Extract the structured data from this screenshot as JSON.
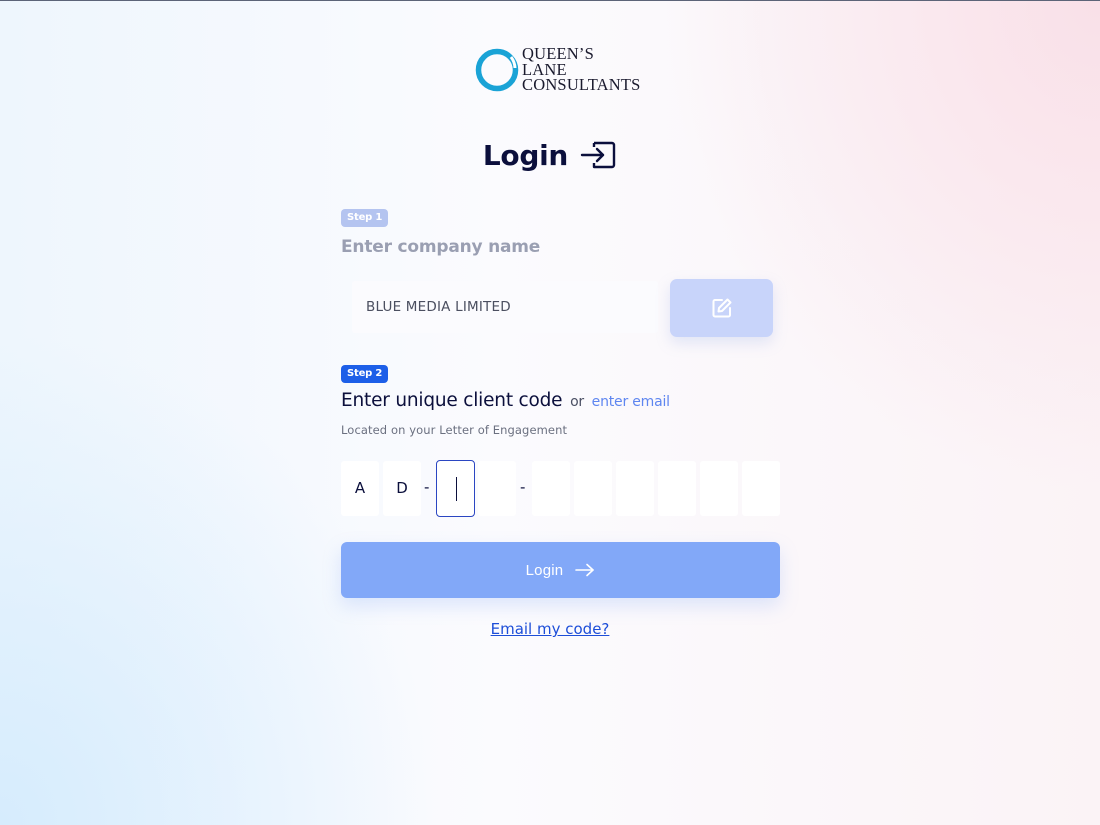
{
  "brand": {
    "logo_lines": [
      "QUEEN’S",
      "LANE",
      "CONSULTANTS"
    ],
    "accent_color": "#1aa3d6"
  },
  "login": {
    "title": "Login",
    "title_icon": "login-enter-icon"
  },
  "step1": {
    "badge": "Step 1",
    "heading": "Enter company name",
    "company_value": "BLUE MEDIA LIMITED",
    "edit_icon": "edit-icon"
  },
  "step2": {
    "badge": "Step 2",
    "heading": "Enter unique client code",
    "or_text": "or",
    "email_link": "enter email",
    "hint": "Located on your Letter of Engagement",
    "code_chars": [
      "A",
      "D",
      "",
      "",
      "",
      "",
      "",
      "",
      "",
      ""
    ],
    "separator": "-"
  },
  "actions": {
    "login_label": "Login",
    "login_icon": "arrow-right-icon",
    "email_code_link": "Email my code?"
  },
  "colors": {
    "primary": "#1d5fe8",
    "button_disabled": "#82a8f8",
    "title_text": "#0b0f3c"
  }
}
